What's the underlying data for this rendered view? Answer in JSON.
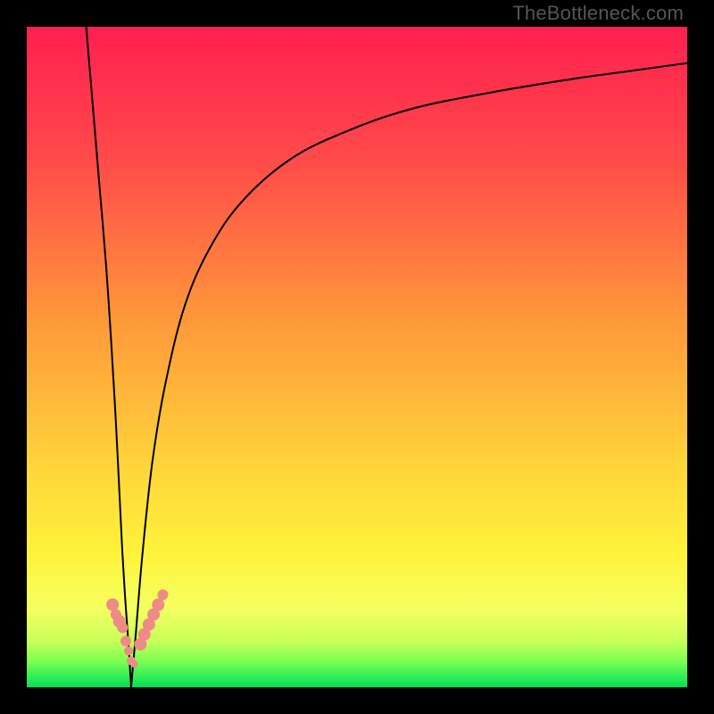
{
  "watermark": "TheBottleneck.com",
  "chart_data": {
    "type": "line",
    "title": "",
    "xlabel": "",
    "ylabel": "",
    "xlim": [
      0,
      100
    ],
    "ylim": [
      0,
      100
    ],
    "grid": false,
    "legend": false,
    "background_gradient": {
      "stops": [
        {
          "y_pct": 0,
          "color": "#ff1f4f"
        },
        {
          "y_pct": 20,
          "color": "#ff4a4a"
        },
        {
          "y_pct": 45,
          "color": "#ff9a3a"
        },
        {
          "y_pct": 68,
          "color": "#ffd83a"
        },
        {
          "y_pct": 80,
          "color": "#fff33a"
        },
        {
          "y_pct": 88,
          "color": "#f5ff60"
        },
        {
          "y_pct": 93,
          "color": "#c8ff5a"
        },
        {
          "y_pct": 96,
          "color": "#7dff50"
        },
        {
          "y_pct": 100,
          "color": "#00e05a"
        }
      ]
    },
    "series": [
      {
        "name": "left-descent",
        "x": [
          9.0,
          10.0,
          11.0,
          12.0,
          12.8,
          13.5,
          14.0,
          14.5,
          15.0,
          15.5,
          15.8
        ],
        "y": [
          100,
          88,
          76,
          64,
          52,
          40,
          30,
          20,
          12,
          5,
          0
        ]
      },
      {
        "name": "right-rise",
        "x": [
          15.8,
          16.5,
          17.5,
          19.0,
          21.0,
          24.0,
          28.0,
          33.0,
          40.0,
          48.0,
          58.0,
          70.0,
          82.0,
          92.0,
          100.0
        ],
        "y": [
          0,
          8,
          20,
          34,
          46,
          58,
          67,
          74,
          80,
          84,
          87.5,
          90,
          92,
          93.4,
          94.5
        ]
      }
    ],
    "markers": [
      {
        "x": 13.0,
        "y": 12.5,
        "r": 7
      },
      {
        "x": 13.5,
        "y": 11.0,
        "r": 6
      },
      {
        "x": 14.0,
        "y": 10.0,
        "r": 7
      },
      {
        "x": 14.5,
        "y": 9.0,
        "r": 6
      },
      {
        "x": 15.0,
        "y": 7.0,
        "r": 6
      },
      {
        "x": 15.4,
        "y": 5.5,
        "r": 5
      },
      {
        "x": 15.8,
        "y": 4.0,
        "r": 5
      },
      {
        "x": 16.3,
        "y": 3.5,
        "r": 4
      },
      {
        "x": 17.2,
        "y": 6.5,
        "r": 7
      },
      {
        "x": 17.8,
        "y": 8.0,
        "r": 7
      },
      {
        "x": 18.5,
        "y": 9.5,
        "r": 7
      },
      {
        "x": 19.2,
        "y": 11.0,
        "r": 7
      },
      {
        "x": 19.9,
        "y": 12.5,
        "r": 7
      },
      {
        "x": 20.6,
        "y": 14.0,
        "r": 6
      }
    ],
    "marker_color": "#f08a86"
  }
}
